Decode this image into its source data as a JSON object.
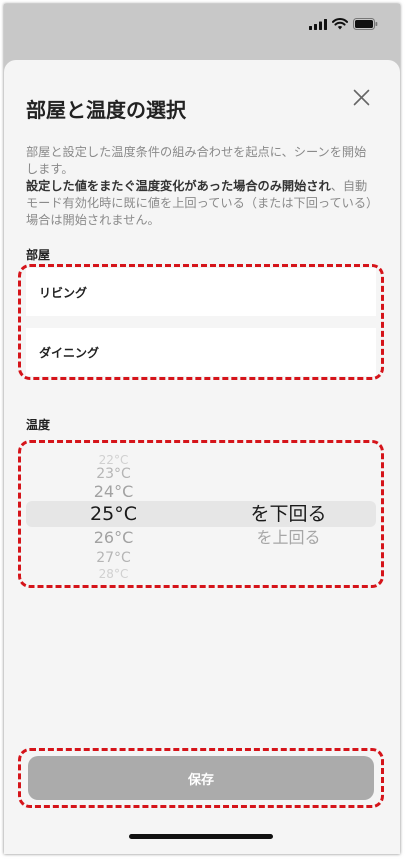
{
  "sheet": {
    "title": "部屋と温度の選択",
    "description_part1": "部屋と設定した温度条件の組み合わせを起点に、シーンを開始します。",
    "description_bold": "設定した値をまたぐ温度変化があった場合のみ開始され",
    "description_part2": "、自動モード有効化時に既に値を上回っている（または下回っている）場合は開始されません。"
  },
  "rooms": {
    "label": "部屋",
    "items": [
      "リビング",
      "ダイニング"
    ]
  },
  "temperature": {
    "label": "温度",
    "options": [
      "22°C",
      "23°C",
      "24°C",
      "25°C",
      "26°C",
      "27°C",
      "28°C"
    ],
    "selected": "25°C",
    "conditions": [
      "を下回る",
      "を上回る"
    ],
    "selected_condition": "を下回る"
  },
  "save_label": "保存",
  "colors": {
    "highlight_dash": "#d5141a",
    "save_disabled": "#ababab"
  }
}
